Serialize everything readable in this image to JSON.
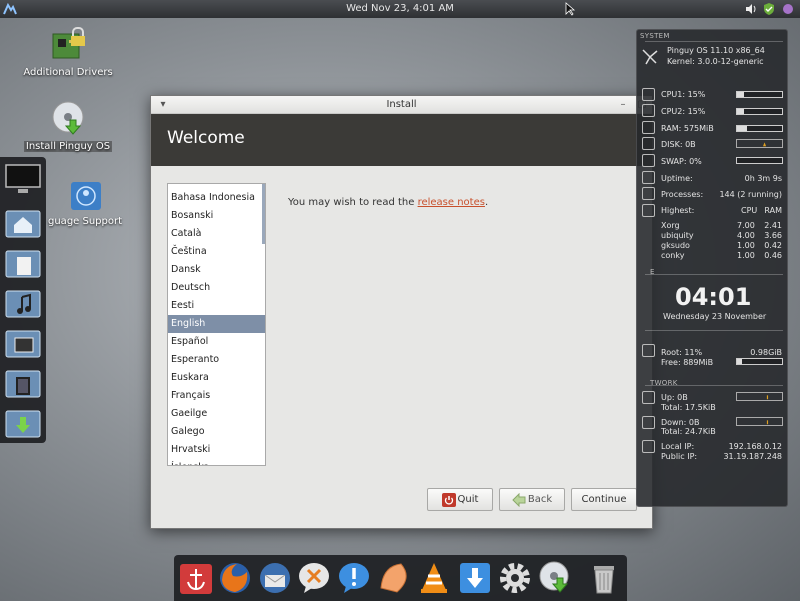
{
  "top_panel": {
    "clock": "Wed Nov 23,  4:01 AM",
    "tray_icons": [
      "volume-icon",
      "shield-icon",
      "system-indicator-icon"
    ]
  },
  "desktop_icons": [
    {
      "name": "additional-drivers",
      "label": "Additional Drivers",
      "icon": "circuit-board-lock-icon"
    },
    {
      "name": "install-pinguy",
      "label": "Install Pinguy OS",
      "icon": "install-disc-icon"
    },
    {
      "name": "language-support",
      "label": "guage Support",
      "icon": "globe-person-icon"
    }
  ],
  "left_dock": [
    "monitor-icon",
    "home-folder-icon",
    "documents-folder-icon",
    "music-folder-icon",
    "pictures-folder-icon",
    "videos-folder-icon",
    "downloads-folder-icon"
  ],
  "conky": {
    "system_header": "SYSTEM",
    "os": "Pinguy OS 11.10 x86_64",
    "kernel": "Kernel: 3.0.0-12-generic",
    "cpu1": {
      "label": "CPU1: 15%",
      "value": 15
    },
    "cpu2": {
      "label": "CPU2: 15%",
      "value": 15
    },
    "ram": {
      "label": "RAM: 575MiB",
      "value": 22
    },
    "disk": "DISK: 0B",
    "swap": {
      "label": "SWAP: 0%",
      "value": 0
    },
    "uptime_label": "Uptime:",
    "uptime_value": "0h 3m 9s",
    "processes_label": "Processes:",
    "processes_value": "144 (2 running)",
    "highest_label": "Highest:",
    "cpu_col": "CPU",
    "ram_col": "RAM",
    "procs": [
      {
        "name": "Xorg",
        "cpu": "7.00",
        "ram": "2.41"
      },
      {
        "name": "ubiquity",
        "cpu": "4.00",
        "ram": "3.66"
      },
      {
        "name": "gksudo",
        "cpu": "1.00",
        "ram": "0.42"
      },
      {
        "name": "conky",
        "cpu": "1.00",
        "ram": "0.46"
      }
    ],
    "time_header": "E",
    "time": "04:01",
    "date": "Wednesday 23 November",
    "root_label": "Root: 11%",
    "root_size": "0.98GiB",
    "free_label": "Free: 889MiB",
    "root_value": 11,
    "network_header": "TWORK",
    "up": "Up: 0B",
    "up_total": "Total: 17.5KiB",
    "down": "Down: 0B",
    "down_total": "Total: 24.7KiB",
    "local_ip_label": "Local IP:",
    "local_ip": "192.168.0.12",
    "public_ip_label": "Public IP:",
    "public_ip": "31.19.187.248"
  },
  "install": {
    "window_title": "Install",
    "header": "Welcome",
    "languages": [
      "Bahasa Indonesia",
      "Bosanski",
      "Català",
      "Čeština",
      "Dansk",
      "Deutsch",
      "Eesti",
      "English",
      "Español",
      "Esperanto",
      "Euskara",
      "Français",
      "Gaeilge",
      "Galego",
      "Hrvatski",
      "Íslenska"
    ],
    "selected_language": "English",
    "notes_prefix": "You may wish to read the ",
    "notes_link": "release notes",
    "notes_suffix": ".",
    "quit": "Quit",
    "back": "Back",
    "continue": "Continue"
  },
  "bottom_dock": [
    "anchor-icon",
    "firefox-icon",
    "thunderbird-icon",
    "chat-icon",
    "notification-icon",
    "slice-icon",
    "vlc-icon",
    "download-icon",
    "settings-gear-icon",
    "install-disc-icon",
    "trash-icon"
  ]
}
